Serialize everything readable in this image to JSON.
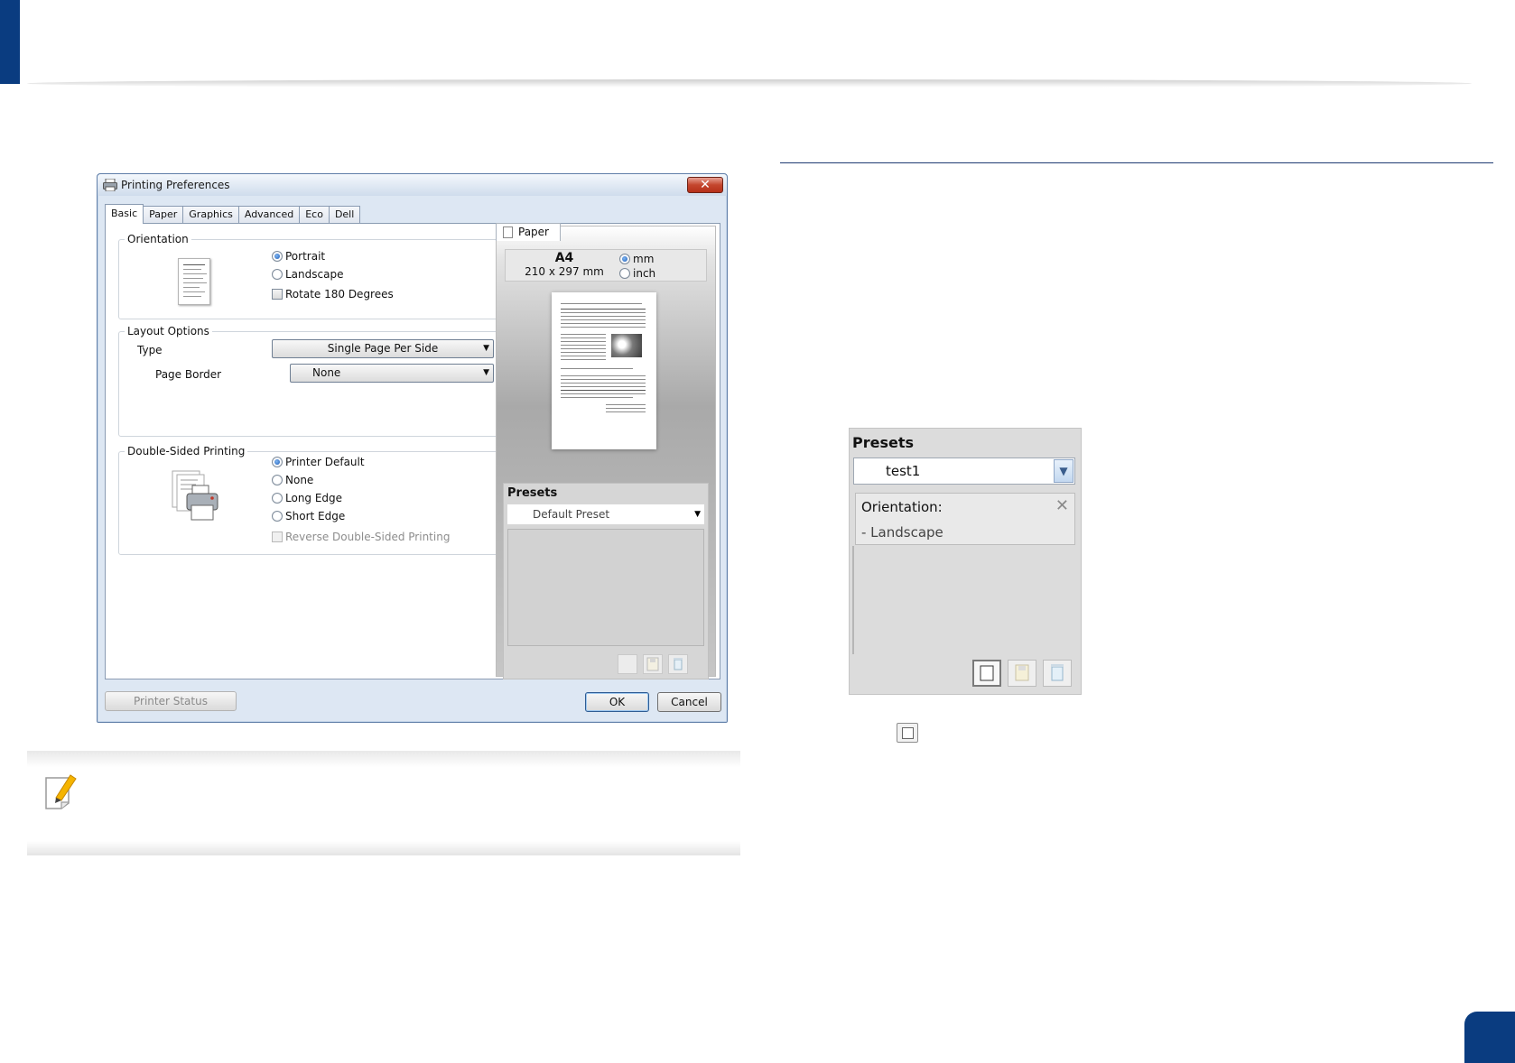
{
  "dialog": {
    "title": "Printing Preferences",
    "close_label": "✕",
    "tabs": [
      {
        "label": "Basic"
      },
      {
        "label": "Paper"
      },
      {
        "label": "Graphics"
      },
      {
        "label": "Advanced"
      },
      {
        "label": "Eco"
      },
      {
        "label": "Dell"
      }
    ],
    "orientation": {
      "legend": "Orientation",
      "portrait": "Portrait",
      "landscape": "Landscape",
      "rotate": "Rotate 180 Degrees"
    },
    "layout": {
      "legend": "Layout Options",
      "type_label": "Type",
      "type_value": "Single Page Per Side",
      "border_label": "Page Border",
      "border_value": "None"
    },
    "duplex": {
      "legend": "Double-Sided Printing",
      "printer_default": "Printer Default",
      "none": "None",
      "long_edge": "Long Edge",
      "short_edge": "Short Edge",
      "reverse": "Reverse Double-Sided Printing"
    },
    "paper_pane": {
      "tab_label": "Paper",
      "size_name": "A4",
      "size_dims": "210 x 297 mm",
      "unit_mm": "mm",
      "unit_inch": "inch"
    },
    "presets": {
      "title": "Presets",
      "selected": "Default Preset"
    },
    "footer": {
      "printer_status": "Printer Status",
      "ok": "OK",
      "cancel": "Cancel"
    }
  },
  "presets_zoom": {
    "title": "Presets",
    "selected": "test1",
    "card_label": "Orientation:",
    "card_value": "- Landscape",
    "card_close": "✕"
  },
  "colors": {
    "brand_blue": "#0a3c80",
    "rule_blue": "#1f3b73"
  }
}
